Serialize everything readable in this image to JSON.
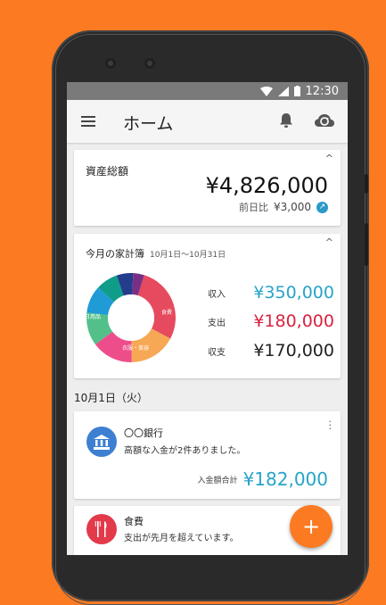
{
  "status": {
    "time": "12:30"
  },
  "appbar": {
    "title": "ホーム"
  },
  "assets": {
    "label": "資産総額",
    "amount": "¥4,826,000",
    "compare_label": "前日比",
    "compare_value": "¥3,000"
  },
  "budget": {
    "label": "今月の家計簿",
    "range": "10月1日〜10月31日",
    "income_label": "収入",
    "income": "¥350,000",
    "expense_label": "支出",
    "expense": "¥180,000",
    "balance_label": "収支",
    "balance": "¥170,000",
    "donut_labels": {
      "food": "食費",
      "daily": "日用品",
      "clothing": "衣服・美容"
    }
  },
  "chart_data": {
    "type": "pie",
    "categories": [
      "食費",
      "衣服・美容",
      "",
      "日用品",
      "",
      "",
      "",
      ""
    ],
    "values": [
      28,
      17,
      15,
      12,
      10,
      8,
      6,
      4
    ],
    "colors": [
      "#e64a5e",
      "#f7a854",
      "#ee4d8b",
      "#53c08a",
      "#1f9bd6",
      "#0f9d8a",
      "#233d8c",
      "#7a2f86"
    ]
  },
  "date_header": "10月1日（火）",
  "bank_card": {
    "name": "〇〇銀行",
    "message": "高額な入金が2件ありました。",
    "total_label": "入金額合計",
    "total": "¥182,000"
  },
  "food_card": {
    "name": "食費",
    "message": "支出が先月を超えています。"
  },
  "colors": {
    "brand_orange": "#fb7a22",
    "income": "#27a4c8",
    "expense": "#d9223f",
    "balance": "#222222"
  },
  "icons": [
    "menu-icon",
    "bell-icon",
    "cloud-sync-icon",
    "bank-icon",
    "fork-knife-icon",
    "plus-icon"
  ]
}
